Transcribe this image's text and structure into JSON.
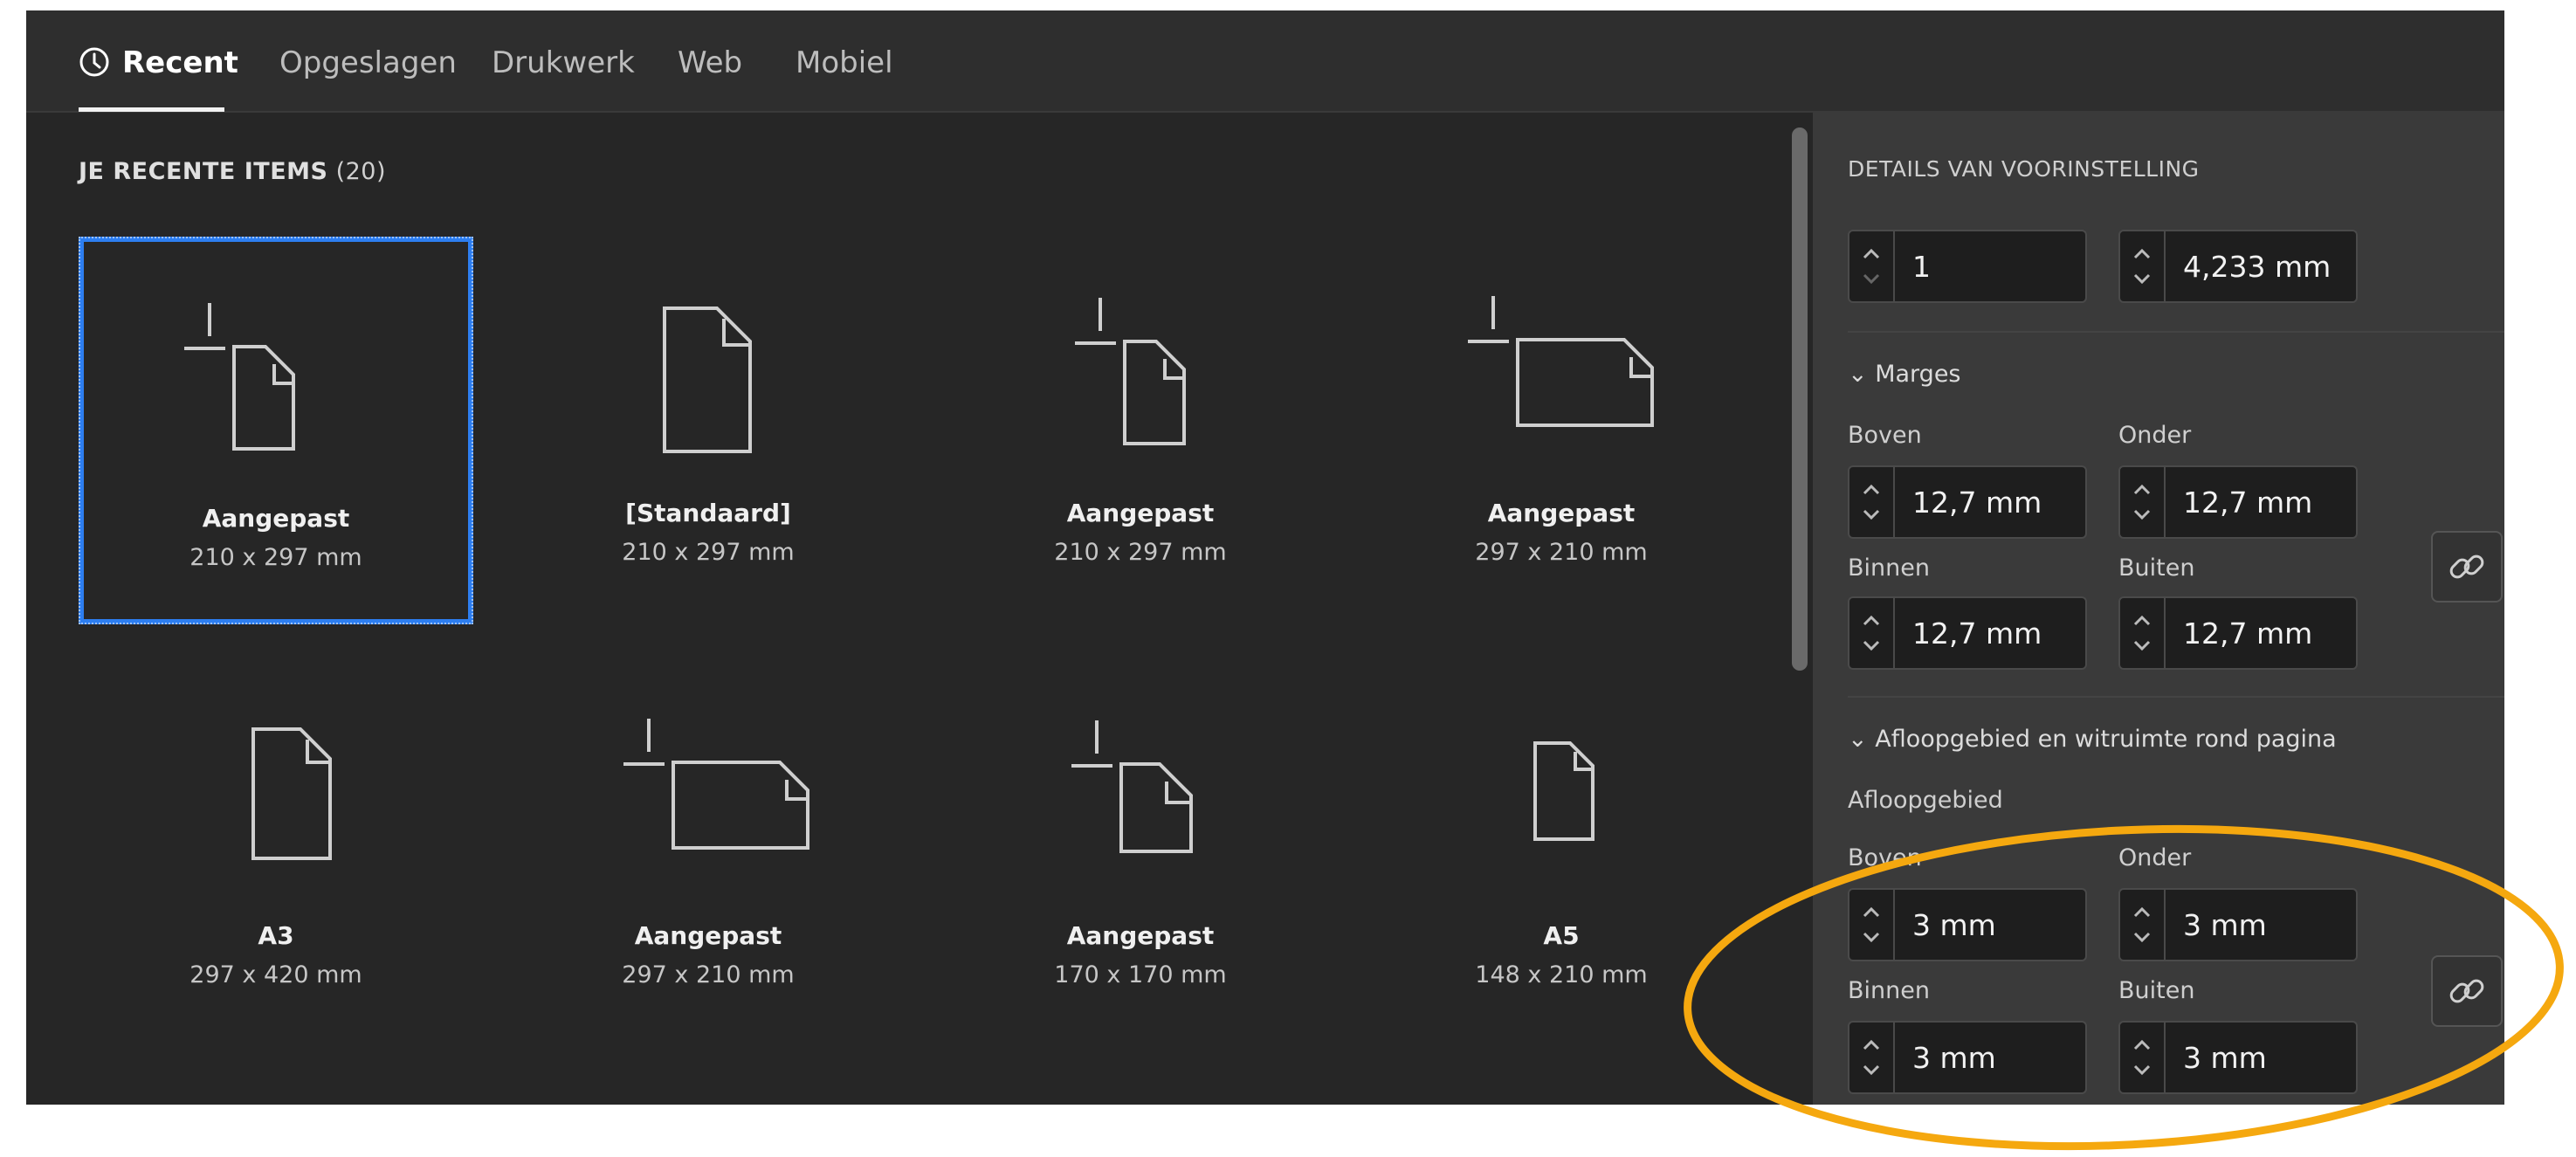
{
  "tabs": [
    {
      "label": "Recent",
      "icon": "clock-icon",
      "active": true
    },
    {
      "label": "Opgeslagen"
    },
    {
      "label": "Drukwerk"
    },
    {
      "label": "Web"
    },
    {
      "label": "Mobiel"
    }
  ],
  "recent": {
    "heading": "JE RECENTE ITEMS",
    "count": "(20)",
    "items": [
      {
        "name": "Aangepast",
        "size": "210 x 297 mm",
        "icon": "custom-portrait-document-icon",
        "selected": true
      },
      {
        "name": "[Standaard]",
        "size": "210 x 297 mm",
        "icon": "portrait-document-icon"
      },
      {
        "name": "Aangepast",
        "size": "210 x 297 mm",
        "icon": "custom-portrait-document-icon"
      },
      {
        "name": "Aangepast",
        "size": "297 x 210 mm",
        "icon": "custom-landscape-document-icon"
      },
      {
        "name": "A3",
        "size": "297 x 420 mm",
        "icon": "portrait-document-icon"
      },
      {
        "name": "Aangepast",
        "size": "297 x 210 mm",
        "icon": "custom-landscape-document-icon"
      },
      {
        "name": "Aangepast",
        "size": "170 x 170 mm",
        "icon": "custom-square-document-icon"
      },
      {
        "name": "A5",
        "size": "148 x 210 mm",
        "icon": "small-portrait-document-icon"
      }
    ]
  },
  "details": {
    "title": "DETAILS VAN VOORINSTELLING",
    "columns": "1",
    "gutter": "4,233 mm",
    "margins": {
      "label": "Marges",
      "top_label": "Boven",
      "top": "12,7 mm",
      "bottom_label": "Onder",
      "bottom": "12,7 mm",
      "inside_label": "Binnen",
      "inside": "12,7 mm",
      "outside_label": "Buiten",
      "outside": "12,7 mm"
    },
    "bleed": {
      "section_label": "Afloopgebied en witruimte rond pagina",
      "label": "Afloopgebied",
      "top_label": "Boven",
      "top": "3 mm",
      "bottom_label": "Onder",
      "bottom": "3 mm",
      "inside_label": "Binnen",
      "inside": "3 mm",
      "outside_label": "Buiten",
      "outside": "3 mm"
    }
  },
  "colors": {
    "accent": "#2d7ef0",
    "highlight": "#f5a80f"
  }
}
